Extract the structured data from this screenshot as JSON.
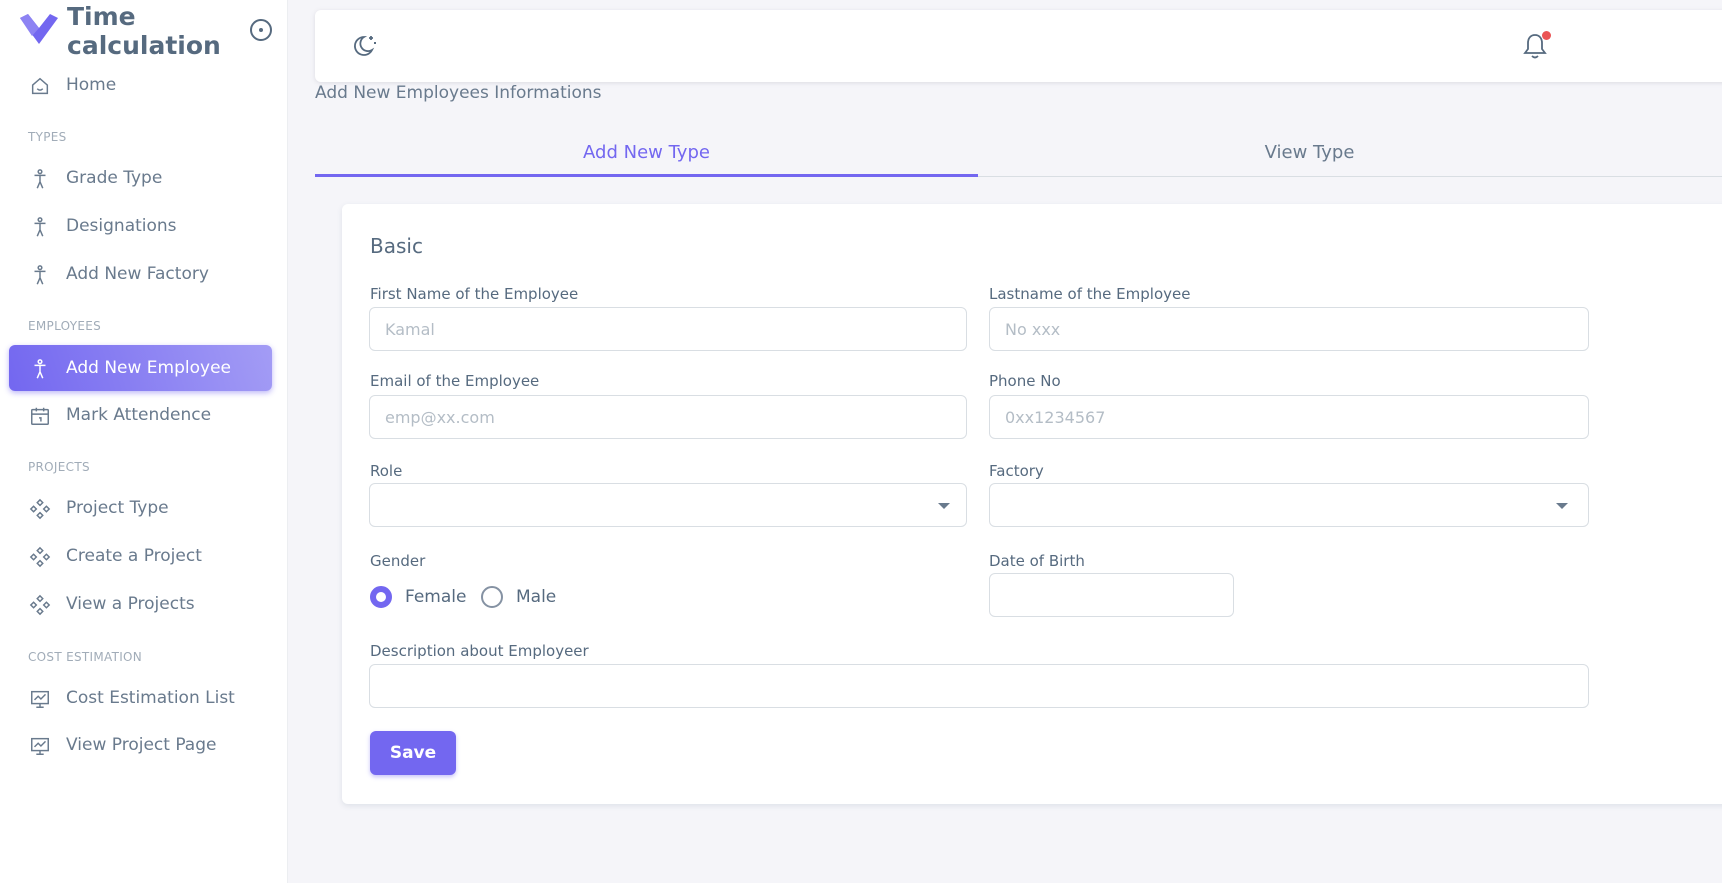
{
  "app": {
    "title": "Time calculation"
  },
  "colors": {
    "accent": "#7367f0",
    "notification_dot": "#ea5455"
  },
  "sidebar": {
    "items": [
      {
        "label": "Home",
        "icon": "home-icon"
      },
      {
        "section": "TYPES"
      },
      {
        "label": "Grade Type",
        "icon": "person-icon"
      },
      {
        "label": "Designations",
        "icon": "person-icon"
      },
      {
        "label": "Add New Factory",
        "icon": "person-icon"
      },
      {
        "section": "EMPLOYEES"
      },
      {
        "label": "Add New Employee",
        "icon": "person-icon",
        "active": true
      },
      {
        "label": "Mark Attendence",
        "icon": "calendar-icon"
      },
      {
        "section": "PROJECTS"
      },
      {
        "label": "Project Type",
        "icon": "components-icon"
      },
      {
        "label": "Create a Project",
        "icon": "components-icon"
      },
      {
        "label": "View a Projects",
        "icon": "components-icon"
      },
      {
        "section": "COST ESTIMATION"
      },
      {
        "label": "Cost Estimation List",
        "icon": "chart-board-icon"
      },
      {
        "label": "View Project Page",
        "icon": "chart-board-icon"
      }
    ]
  },
  "navbar": {
    "theme_icon": "moon-icon",
    "notification_icon": "bell-icon"
  },
  "page": {
    "heading": "Add New Employees Informations"
  },
  "tabs": [
    {
      "label": "Add New Type",
      "active": true
    },
    {
      "label": "View Type",
      "active": false
    }
  ],
  "form": {
    "section_title": "Basic",
    "first_name": {
      "label": "First Name of the Employee",
      "placeholder": "Kamal",
      "value": ""
    },
    "last_name": {
      "label": "Lastname of the Employee",
      "placeholder": "No xxx",
      "value": ""
    },
    "email": {
      "label": "Email of the Employee",
      "placeholder": "emp@xx.com",
      "value": ""
    },
    "phone": {
      "label": "Phone No",
      "placeholder": "0xx1234567",
      "value": ""
    },
    "role": {
      "label": "Role",
      "value": ""
    },
    "factory": {
      "label": "Factory",
      "value": ""
    },
    "gender": {
      "label": "Gender",
      "options": [
        "Female",
        "Male"
      ],
      "selected": "Female"
    },
    "dob": {
      "label": "Date of Birth",
      "value": ""
    },
    "description": {
      "label": "Description about Employeer",
      "value": ""
    },
    "save_label": "Save"
  }
}
